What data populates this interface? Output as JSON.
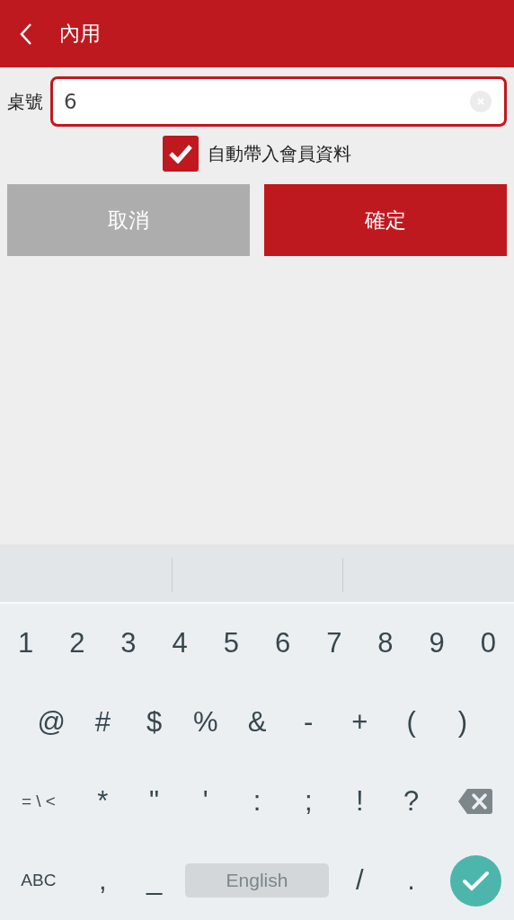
{
  "header": {
    "title": "內用"
  },
  "table_field": {
    "label": "桌號",
    "value": "6"
  },
  "auto_fill": {
    "label": "自動帶入會員資料",
    "checked": true
  },
  "buttons": [
    {
      "label": "取消",
      "kind": "cancel"
    },
    {
      "label": "確定",
      "kind": "confirm"
    }
  ],
  "keyboard": {
    "key_lines": [
      [
        {
          "label": "1",
          "kind": "key"
        },
        {
          "label": "2",
          "kind": "key"
        },
        {
          "label": "3",
          "kind": "key"
        },
        {
          "label": "4",
          "kind": "key"
        },
        {
          "label": "5",
          "kind": "key"
        },
        {
          "label": "6",
          "kind": "key"
        },
        {
          "label": "7",
          "kind": "key"
        },
        {
          "label": "8",
          "kind": "key"
        },
        {
          "label": "9",
          "kind": "key"
        },
        {
          "label": "0",
          "kind": "key"
        }
      ],
      [
        {
          "label": "@",
          "kind": "key"
        },
        {
          "label": "#",
          "kind": "key"
        },
        {
          "label": "$",
          "kind": "key"
        },
        {
          "label": "%",
          "kind": "key"
        },
        {
          "label": "&",
          "kind": "key"
        },
        {
          "label": "-",
          "kind": "key"
        },
        {
          "label": "+",
          "kind": "key"
        },
        {
          "label": "(",
          "kind": "key"
        },
        {
          "label": ")",
          "kind": "key"
        }
      ],
      [
        {
          "label": "= \\ <",
          "kind": "mode"
        },
        {
          "label": "*",
          "kind": "key"
        },
        {
          "label": "\"",
          "kind": "key"
        },
        {
          "label": "'",
          "kind": "key"
        },
        {
          "label": ":",
          "kind": "key"
        },
        {
          "label": ";",
          "kind": "key"
        },
        {
          "label": "!",
          "kind": "key"
        },
        {
          "label": "?",
          "kind": "key"
        },
        {
          "kind": "backspace"
        }
      ],
      [
        {
          "label": "ABC",
          "kind": "mode"
        },
        {
          "label": ",",
          "kind": "key"
        },
        {
          "label": "_",
          "kind": "key"
        },
        {
          "label": "English",
          "kind": "space"
        },
        {
          "label": "/",
          "kind": "key"
        },
        {
          "label": ".",
          "kind": "key"
        },
        {
          "kind": "enter"
        }
      ]
    ]
  }
}
